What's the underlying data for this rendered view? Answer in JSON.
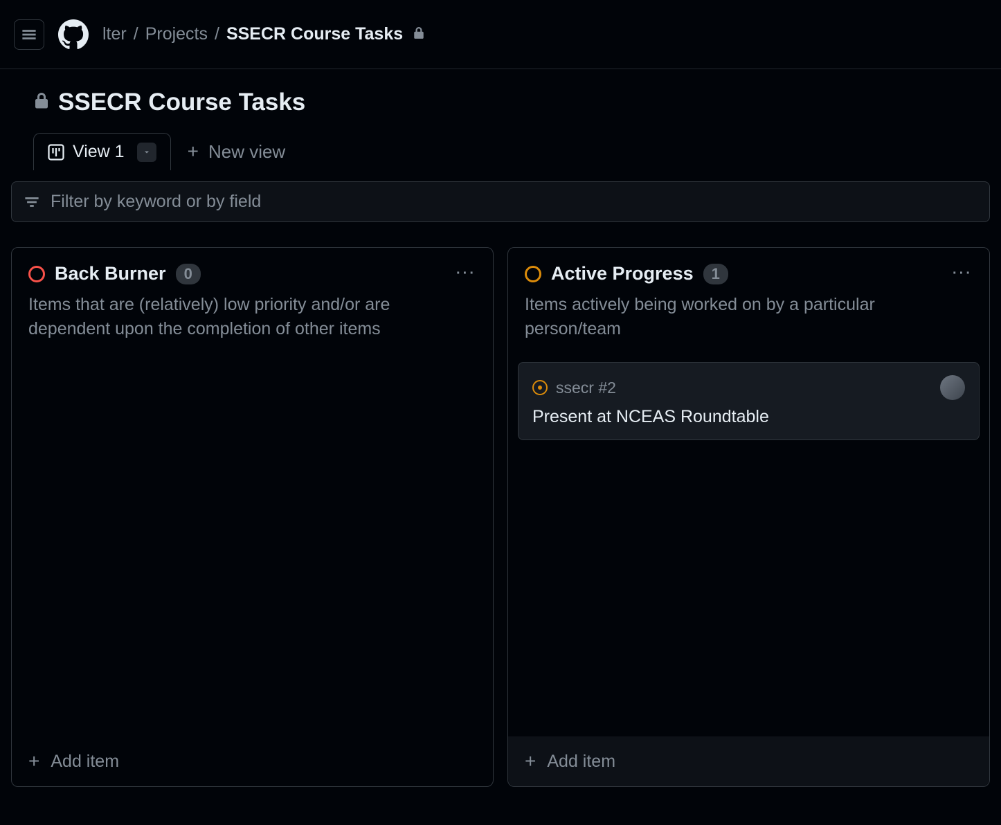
{
  "breadcrumb": {
    "org": "lter",
    "section": "Projects",
    "project": "SSECR Course Tasks"
  },
  "project_title": "SSECR Course Tasks",
  "tabs": {
    "view1": "View 1",
    "new_view": "New view"
  },
  "filter": {
    "placeholder": "Filter by keyword or by field"
  },
  "columns": [
    {
      "title": "Back Burner",
      "count": "0",
      "status_color": "red",
      "description": "Items that are (relatively) low priority and/or are dependent upon the completion of other items",
      "cards": [],
      "add_label": "Add item"
    },
    {
      "title": "Active Progress",
      "count": "1",
      "status_color": "orange",
      "description": "Items actively being worked on by a particular person/team",
      "cards": [
        {
          "ref": "ssecr #2",
          "title": "Present at NCEAS Roundtable"
        }
      ],
      "add_label": "Add item"
    }
  ]
}
